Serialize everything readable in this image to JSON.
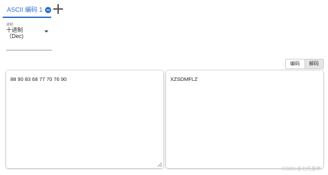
{
  "tabs": [
    {
      "label": "ASCII 编码 1",
      "active": true
    }
  ],
  "base_select": {
    "caption": "进制",
    "value": "十进制\n（Dec)"
  },
  "mode": {
    "encode_label": "编码",
    "decode_label": "解码",
    "active": "decode"
  },
  "input": {
    "value": "88 90 83 68 77 70 76 90"
  },
  "output": {
    "value": "XZSDMFLZ"
  },
  "watermark": "CSDN @七月是年",
  "colors": {
    "accent": "#2f6fd0",
    "active_toggle_bg": "#e6e6e6"
  }
}
